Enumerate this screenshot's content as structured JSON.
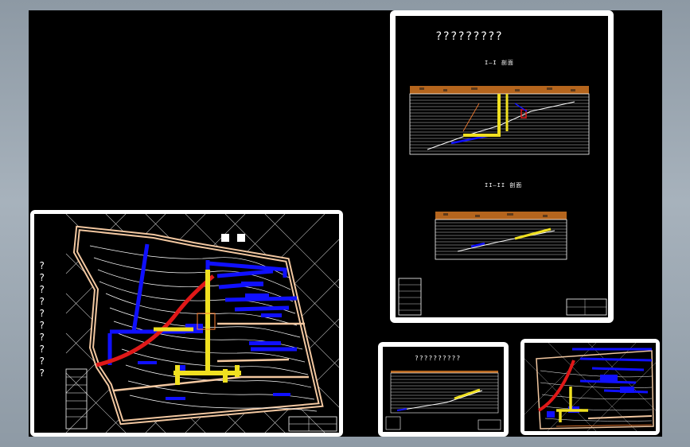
{
  "sheet_main": {
    "side_title": [
      "?",
      "?",
      "?",
      "?",
      "?",
      "?",
      "?",
      "?",
      "?",
      "?"
    ]
  },
  "sheet_sections": {
    "title": "?????????",
    "section_a_label": "I—I 剖面",
    "section_b_label": "II—II 剖面"
  },
  "sheet_small": {
    "title": "??????????"
  },
  "colors": {
    "background": "#000000",
    "sheet_border": "#ffffff",
    "pipe_blue": "#1010ff",
    "pipe_red": "#e01818",
    "pipe_yellow": "#f0e020",
    "soil": "#b5651d",
    "contour": "#ffffff"
  }
}
